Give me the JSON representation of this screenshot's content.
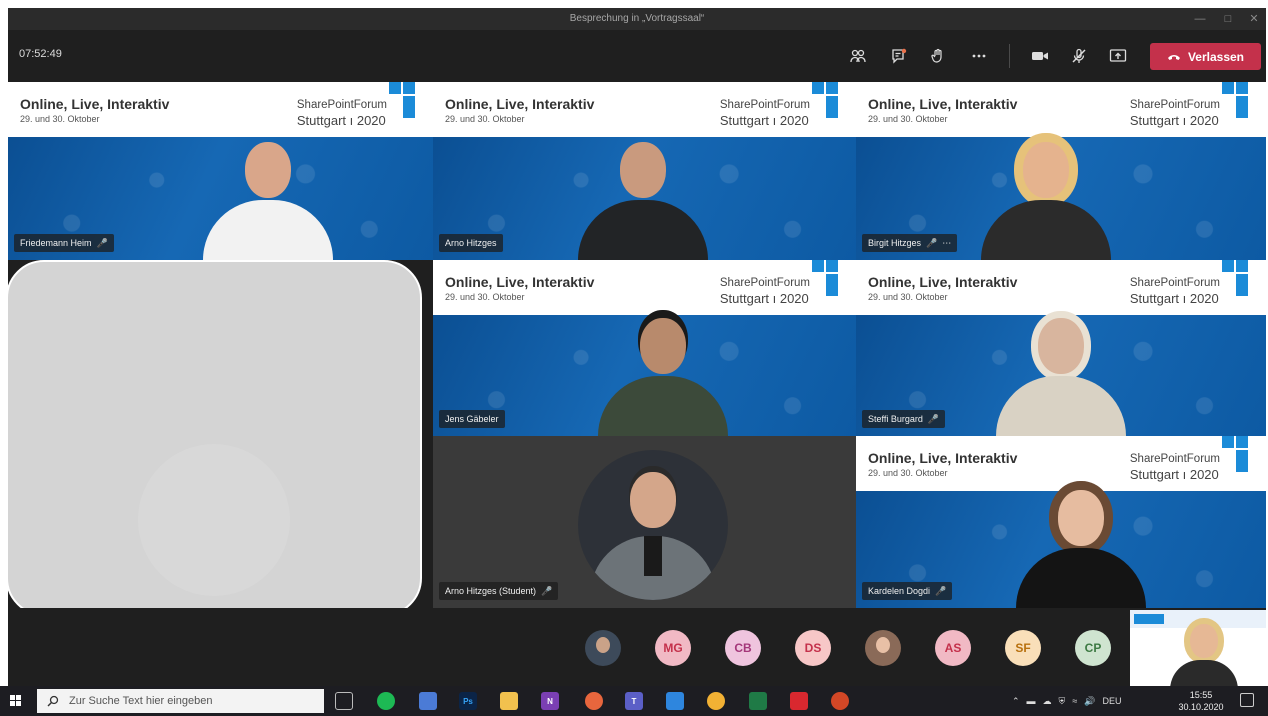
{
  "window": {
    "title": "Besprechung in „Vortragssaal“"
  },
  "toolbar": {
    "clock": "07:52:49",
    "leave_label": "Verlassen",
    "icons": [
      "people-icon",
      "chat-icon",
      "raise-hand-icon",
      "more-icon",
      "camera-icon",
      "mic-off-icon",
      "share-screen-icon"
    ]
  },
  "banner": {
    "title": "Online, Live, Interaktiv",
    "date": "29. und 30. Oktober",
    "brand_line1": "SharePointForum",
    "brand_line2": "Stuttgart ı 2020"
  },
  "tiles": [
    {
      "name": "Friedemann Heim"
    },
    {
      "name": "Arno Hitzges"
    },
    {
      "name": "Birgit Hitzges"
    },
    {
      "name": "Jens Gäbeler"
    },
    {
      "name": "Steffi Burgard"
    },
    {
      "name": "Arno Hitzges (Student)"
    },
    {
      "name": "Kardelen Dogdi"
    }
  ],
  "participants": [
    {
      "initials": "",
      "photo": true
    },
    {
      "initials": "MG",
      "bg": "#f1b9c4",
      "fg": "#c4314b"
    },
    {
      "initials": "CB",
      "bg": "#efc4de",
      "fg": "#a4377a"
    },
    {
      "initials": "DS",
      "bg": "#f7c7c7",
      "fg": "#c4314b"
    },
    {
      "initials": "",
      "photo": true
    },
    {
      "initials": "AS",
      "bg": "#f1b9c4",
      "fg": "#c4314b"
    },
    {
      "initials": "SF",
      "bg": "#f9dfb9",
      "fg": "#b8710f"
    },
    {
      "initials": "CP",
      "bg": "#cfe4d0",
      "fg": "#3d7a43"
    }
  ],
  "taskbar": {
    "search_placeholder": "Zur Suche Text hier eingeben",
    "lang": "DEU",
    "time": "15:55",
    "date": "30.10.2020"
  }
}
